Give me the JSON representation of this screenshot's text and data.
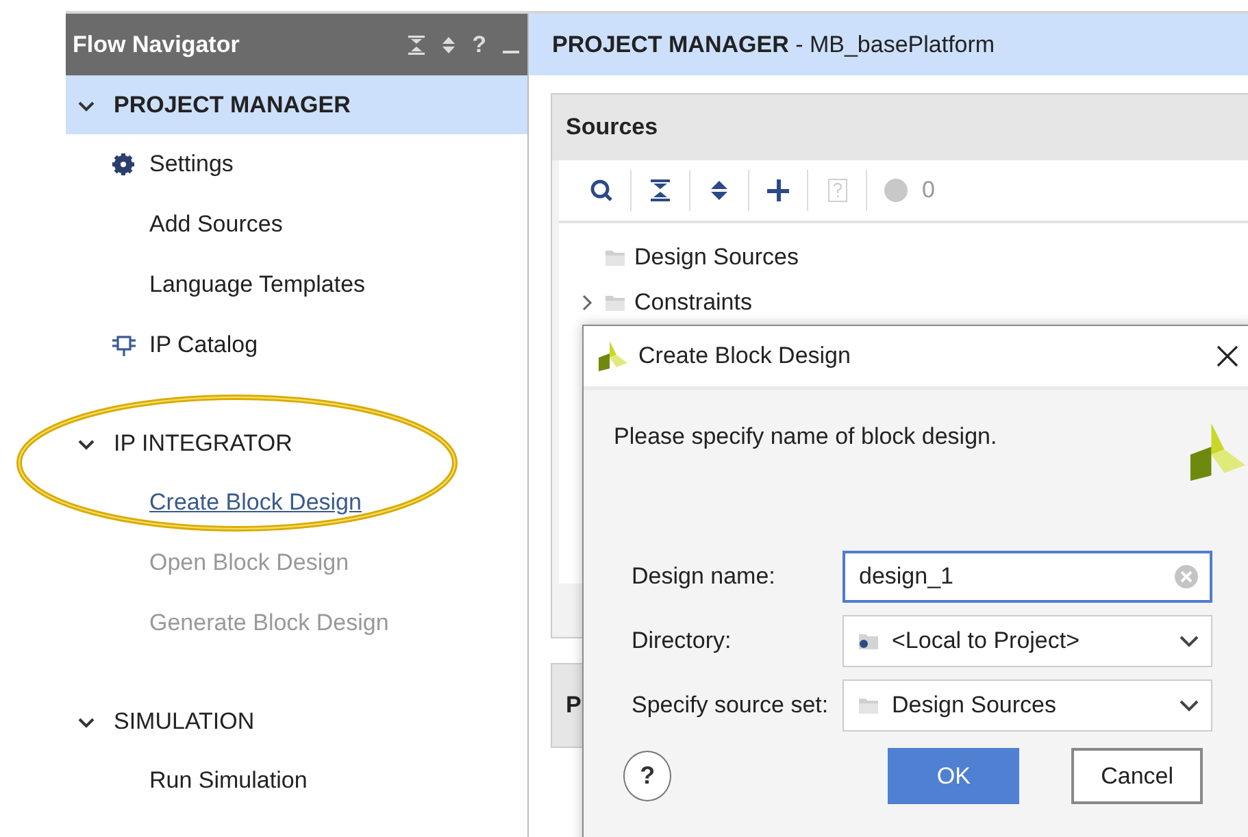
{
  "flow_navigator": {
    "title": "Flow Navigator",
    "help": "?",
    "sections": [
      {
        "title": "PROJECT MANAGER",
        "expanded": true,
        "selected": true,
        "circled": false,
        "items": [
          {
            "label": "Settings",
            "kind": "settings",
            "disabled": false,
            "hovered": false
          },
          {
            "label": "Add Sources",
            "disabled": false,
            "hovered": false
          },
          {
            "label": "Language Templates",
            "disabled": false,
            "hovered": false
          },
          {
            "label": "IP Catalog",
            "kind": "catalog",
            "disabled": false,
            "hovered": false
          }
        ]
      },
      {
        "title": "IP INTEGRATOR",
        "expanded": true,
        "selected": false,
        "circled": true,
        "items": [
          {
            "label": "Create Block Design",
            "disabled": false,
            "hovered": true
          },
          {
            "label": "Open Block Design",
            "disabled": true,
            "hovered": false
          },
          {
            "label": "Generate Block Design",
            "disabled": true,
            "hovered": false
          }
        ]
      },
      {
        "title": "SIMULATION",
        "expanded": true,
        "selected": false,
        "circled": false,
        "items": [
          {
            "label": "Run Simulation",
            "disabled": false,
            "hovered": false
          }
        ]
      }
    ]
  },
  "main": {
    "title": "**PROJECT MANAGER** - MB_basePlatform",
    "sources": {
      "title": "Sources",
      "tools": [
        {
          "kind": "search",
          "disabled": false
        },
        {
          "kind": "collapse",
          "disabled": false
        },
        {
          "kind": "expand",
          "disabled": false
        },
        {
          "kind": "add",
          "disabled": false
        },
        {
          "kind": "help",
          "disabled": true
        }
      ],
      "warning_count": "0",
      "tree": [
        {
          "label": "Design Sources"
        },
        {
          "label": "Constraints",
          "expanded": false
        }
      ]
    },
    "panel_2": {
      "title": "P"
    }
  },
  "dialog": {
    "title": "Create Block Design",
    "message": "Please specify name of block design.",
    "fields": [
      {
        "kind": "text",
        "label": "Design name:",
        "value": "design_1",
        "focused": true
      },
      {
        "kind": "directory",
        "label": "Directory:",
        "value": "<Local to Project>"
      },
      {
        "kind": "sourceset",
        "label": "Specify source set:",
        "value": "Design Sources"
      }
    ],
    "help": "?",
    "buttons": [
      {
        "label": "OK",
        "default": true
      },
      {
        "label": "Cancel",
        "default": false
      }
    ]
  }
}
